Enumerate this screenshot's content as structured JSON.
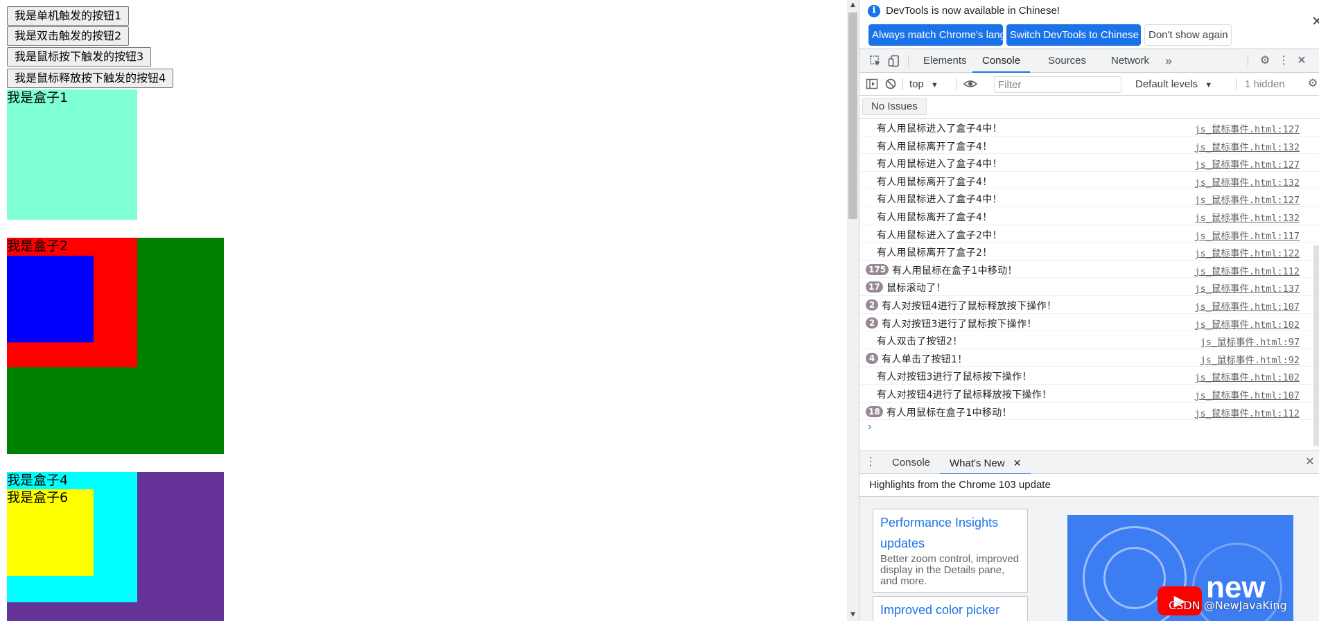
{
  "page": {
    "buttons": [
      "我是单机触发的按钮1",
      "我是双击触发的按钮2",
      "我是鼠标按下触发的按钮3",
      "我是鼠标释放按下触发的按钮4"
    ],
    "boxes": {
      "box1": "我是盒子1",
      "box2": "我是盒子2",
      "box4": "我是盒子4",
      "box6": "我是盒子6"
    },
    "colors": {
      "box1": "#7fffd4",
      "box2_outer": "#008000",
      "box2_inner": "#ff0000",
      "box3": "#0000ff",
      "box4_outer": "#663399",
      "box4_inner": "#00ffff",
      "box6": "#ffff00"
    }
  },
  "devtools": {
    "infobar": {
      "message": "DevTools is now available in Chinese!",
      "btn_match": "Always match Chrome's language",
      "btn_switch": "Switch DevTools to Chinese",
      "btn_dont_show": "Don't show again"
    },
    "tabs": [
      "Elements",
      "Console",
      "Sources",
      "Network"
    ],
    "active_tab": "Console",
    "console_toolbar": {
      "context": "top",
      "filter_placeholder": "Filter",
      "levels": "Default levels",
      "hidden": "1 hidden"
    },
    "issues": "No Issues",
    "messages": [
      {
        "count": "",
        "text": "有人用鼠标进入了盒子4中！",
        "source": "js_鼠标事件.html:127"
      },
      {
        "count": "",
        "text": "有人用鼠标离开了盒子4！",
        "source": "js_鼠标事件.html:132"
      },
      {
        "count": "",
        "text": "有人用鼠标进入了盒子4中！",
        "source": "js_鼠标事件.html:127"
      },
      {
        "count": "",
        "text": "有人用鼠标离开了盒子4！",
        "source": "js_鼠标事件.html:132"
      },
      {
        "count": "",
        "text": "有人用鼠标进入了盒子4中！",
        "source": "js_鼠标事件.html:127"
      },
      {
        "count": "",
        "text": "有人用鼠标离开了盒子4！",
        "source": "js_鼠标事件.html:132"
      },
      {
        "count": "",
        "text": "有人用鼠标进入了盒子2中！",
        "source": "js_鼠标事件.html:117"
      },
      {
        "count": "",
        "text": "有人用鼠标离开了盒子2！",
        "source": "js_鼠标事件.html:122"
      },
      {
        "count": "175",
        "text": "有人用鼠标在盒子1中移动！",
        "source": "js_鼠标事件.html:112"
      },
      {
        "count": "17",
        "text": "鼠标滚动了！",
        "source": "js_鼠标事件.html:137"
      },
      {
        "count": "2",
        "text": "有人对按钮4进行了鼠标释放按下操作！",
        "source": "js_鼠标事件.html:107"
      },
      {
        "count": "2",
        "text": "有人对按钮3进行了鼠标按下操作！",
        "source": "js_鼠标事件.html:102"
      },
      {
        "count": "",
        "text": "有人双击了按钮2！",
        "source": "js_鼠标事件.html:97"
      },
      {
        "count": "4",
        "text": "有人单击了按钮1！",
        "source": "js_鼠标事件.html:92"
      },
      {
        "count": "",
        "text": "有人对按钮3进行了鼠标按下操作！",
        "source": "js_鼠标事件.html:102"
      },
      {
        "count": "",
        "text": "有人对按钮4进行了鼠标释放按下操作！",
        "source": "js_鼠标事件.html:107"
      },
      {
        "count": "18",
        "text": "有人用鼠标在盒子1中移动！",
        "source": "js_鼠标事件.html:112"
      }
    ],
    "drawer": {
      "tabs": [
        "Console",
        "What's New"
      ],
      "active_tab": "What's New",
      "highlights": "Highlights from the Chrome 103 update",
      "cards": [
        {
          "title": "Performance Insights updates",
          "desc": "Better zoom control, improved display in the Details pane, and more."
        },
        {
          "title": "Improved color picker",
          "desc": ""
        }
      ],
      "watermark": "CSDN @NewJavaKing"
    }
  }
}
